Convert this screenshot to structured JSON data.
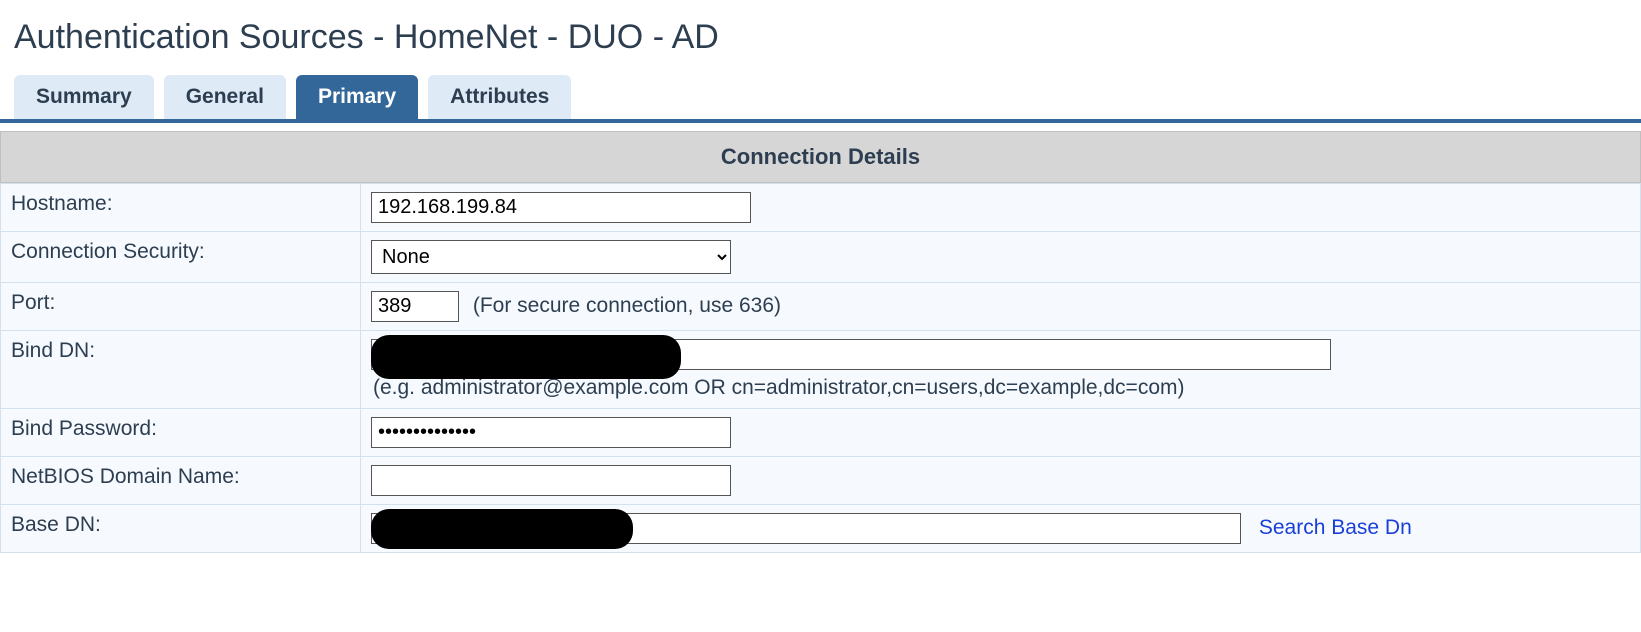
{
  "page_title": "Authentication Sources - HomeNet - DUO - AD",
  "tabs": [
    {
      "label": "Summary",
      "active": false
    },
    {
      "label": "General",
      "active": false
    },
    {
      "label": "Primary",
      "active": true
    },
    {
      "label": "Attributes",
      "active": false
    }
  ],
  "section_header": "Connection Details",
  "form": {
    "hostname": {
      "label": "Hostname:",
      "value": "192.168.199.84"
    },
    "connection_security": {
      "label": "Connection Security:",
      "selected": "None"
    },
    "port": {
      "label": "Port:",
      "value": "389",
      "hint": "(For secure connection, use 636)"
    },
    "bind_dn": {
      "label": "Bind DN:",
      "value": "",
      "help": "(e.g. administrator@example.com OR cn=administrator,cn=users,dc=example,dc=com)"
    },
    "bind_password": {
      "label": "Bind Password:",
      "value": "••••••••••••••"
    },
    "netbios": {
      "label": "NetBIOS Domain Name:",
      "value": ""
    },
    "base_dn": {
      "label": "Base DN:",
      "value": "",
      "search_link": "Search Base Dn"
    }
  }
}
